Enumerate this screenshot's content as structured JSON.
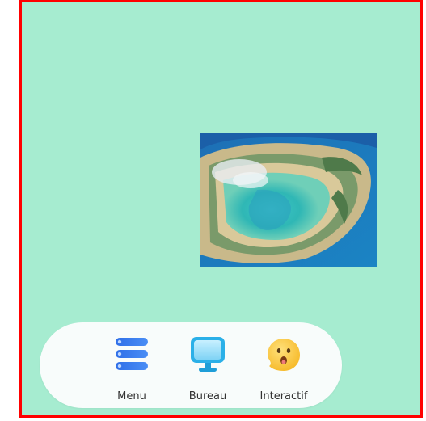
{
  "dock": {
    "items": [
      {
        "label": "Menu",
        "icon": "menu-stack-icon"
      },
      {
        "label": "Bureau",
        "icon": "monitor-icon"
      },
      {
        "label": "Interactif",
        "icon": "emoji-face-icon"
      }
    ]
  },
  "colors": {
    "desktop_background": "#a6ecd0",
    "frame_border": "#ff0000",
    "dock_background": "#f8fcfb"
  }
}
